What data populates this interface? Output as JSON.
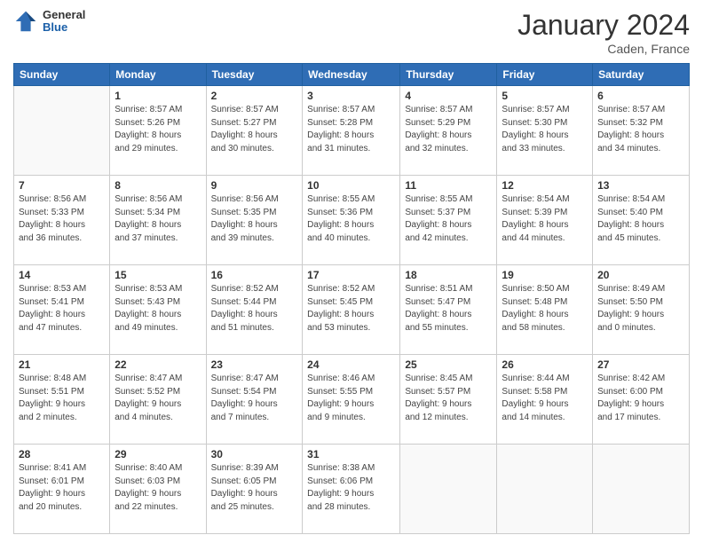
{
  "header": {
    "logo_general": "General",
    "logo_blue": "Blue",
    "month_title": "January 2024",
    "location": "Caden, France"
  },
  "calendar": {
    "days_of_week": [
      "Sunday",
      "Monday",
      "Tuesday",
      "Wednesday",
      "Thursday",
      "Friday",
      "Saturday"
    ],
    "weeks": [
      [
        {
          "day": "",
          "info": ""
        },
        {
          "day": "1",
          "info": "Sunrise: 8:57 AM\nSunset: 5:26 PM\nDaylight: 8 hours\nand 29 minutes."
        },
        {
          "day": "2",
          "info": "Sunrise: 8:57 AM\nSunset: 5:27 PM\nDaylight: 8 hours\nand 30 minutes."
        },
        {
          "day": "3",
          "info": "Sunrise: 8:57 AM\nSunset: 5:28 PM\nDaylight: 8 hours\nand 31 minutes."
        },
        {
          "day": "4",
          "info": "Sunrise: 8:57 AM\nSunset: 5:29 PM\nDaylight: 8 hours\nand 32 minutes."
        },
        {
          "day": "5",
          "info": "Sunrise: 8:57 AM\nSunset: 5:30 PM\nDaylight: 8 hours\nand 33 minutes."
        },
        {
          "day": "6",
          "info": "Sunrise: 8:57 AM\nSunset: 5:32 PM\nDaylight: 8 hours\nand 34 minutes."
        }
      ],
      [
        {
          "day": "7",
          "info": "Sunrise: 8:56 AM\nSunset: 5:33 PM\nDaylight: 8 hours\nand 36 minutes."
        },
        {
          "day": "8",
          "info": "Sunrise: 8:56 AM\nSunset: 5:34 PM\nDaylight: 8 hours\nand 37 minutes."
        },
        {
          "day": "9",
          "info": "Sunrise: 8:56 AM\nSunset: 5:35 PM\nDaylight: 8 hours\nand 39 minutes."
        },
        {
          "day": "10",
          "info": "Sunrise: 8:55 AM\nSunset: 5:36 PM\nDaylight: 8 hours\nand 40 minutes."
        },
        {
          "day": "11",
          "info": "Sunrise: 8:55 AM\nSunset: 5:37 PM\nDaylight: 8 hours\nand 42 minutes."
        },
        {
          "day": "12",
          "info": "Sunrise: 8:54 AM\nSunset: 5:39 PM\nDaylight: 8 hours\nand 44 minutes."
        },
        {
          "day": "13",
          "info": "Sunrise: 8:54 AM\nSunset: 5:40 PM\nDaylight: 8 hours\nand 45 minutes."
        }
      ],
      [
        {
          "day": "14",
          "info": "Sunrise: 8:53 AM\nSunset: 5:41 PM\nDaylight: 8 hours\nand 47 minutes."
        },
        {
          "day": "15",
          "info": "Sunrise: 8:53 AM\nSunset: 5:43 PM\nDaylight: 8 hours\nand 49 minutes."
        },
        {
          "day": "16",
          "info": "Sunrise: 8:52 AM\nSunset: 5:44 PM\nDaylight: 8 hours\nand 51 minutes."
        },
        {
          "day": "17",
          "info": "Sunrise: 8:52 AM\nSunset: 5:45 PM\nDaylight: 8 hours\nand 53 minutes."
        },
        {
          "day": "18",
          "info": "Sunrise: 8:51 AM\nSunset: 5:47 PM\nDaylight: 8 hours\nand 55 minutes."
        },
        {
          "day": "19",
          "info": "Sunrise: 8:50 AM\nSunset: 5:48 PM\nDaylight: 8 hours\nand 58 minutes."
        },
        {
          "day": "20",
          "info": "Sunrise: 8:49 AM\nSunset: 5:50 PM\nDaylight: 9 hours\nand 0 minutes."
        }
      ],
      [
        {
          "day": "21",
          "info": "Sunrise: 8:48 AM\nSunset: 5:51 PM\nDaylight: 9 hours\nand 2 minutes."
        },
        {
          "day": "22",
          "info": "Sunrise: 8:47 AM\nSunset: 5:52 PM\nDaylight: 9 hours\nand 4 minutes."
        },
        {
          "day": "23",
          "info": "Sunrise: 8:47 AM\nSunset: 5:54 PM\nDaylight: 9 hours\nand 7 minutes."
        },
        {
          "day": "24",
          "info": "Sunrise: 8:46 AM\nSunset: 5:55 PM\nDaylight: 9 hours\nand 9 minutes."
        },
        {
          "day": "25",
          "info": "Sunrise: 8:45 AM\nSunset: 5:57 PM\nDaylight: 9 hours\nand 12 minutes."
        },
        {
          "day": "26",
          "info": "Sunrise: 8:44 AM\nSunset: 5:58 PM\nDaylight: 9 hours\nand 14 minutes."
        },
        {
          "day": "27",
          "info": "Sunrise: 8:42 AM\nSunset: 6:00 PM\nDaylight: 9 hours\nand 17 minutes."
        }
      ],
      [
        {
          "day": "28",
          "info": "Sunrise: 8:41 AM\nSunset: 6:01 PM\nDaylight: 9 hours\nand 20 minutes."
        },
        {
          "day": "29",
          "info": "Sunrise: 8:40 AM\nSunset: 6:03 PM\nDaylight: 9 hours\nand 22 minutes."
        },
        {
          "day": "30",
          "info": "Sunrise: 8:39 AM\nSunset: 6:05 PM\nDaylight: 9 hours\nand 25 minutes."
        },
        {
          "day": "31",
          "info": "Sunrise: 8:38 AM\nSunset: 6:06 PM\nDaylight: 9 hours\nand 28 minutes."
        },
        {
          "day": "",
          "info": ""
        },
        {
          "day": "",
          "info": ""
        },
        {
          "day": "",
          "info": ""
        }
      ]
    ]
  }
}
